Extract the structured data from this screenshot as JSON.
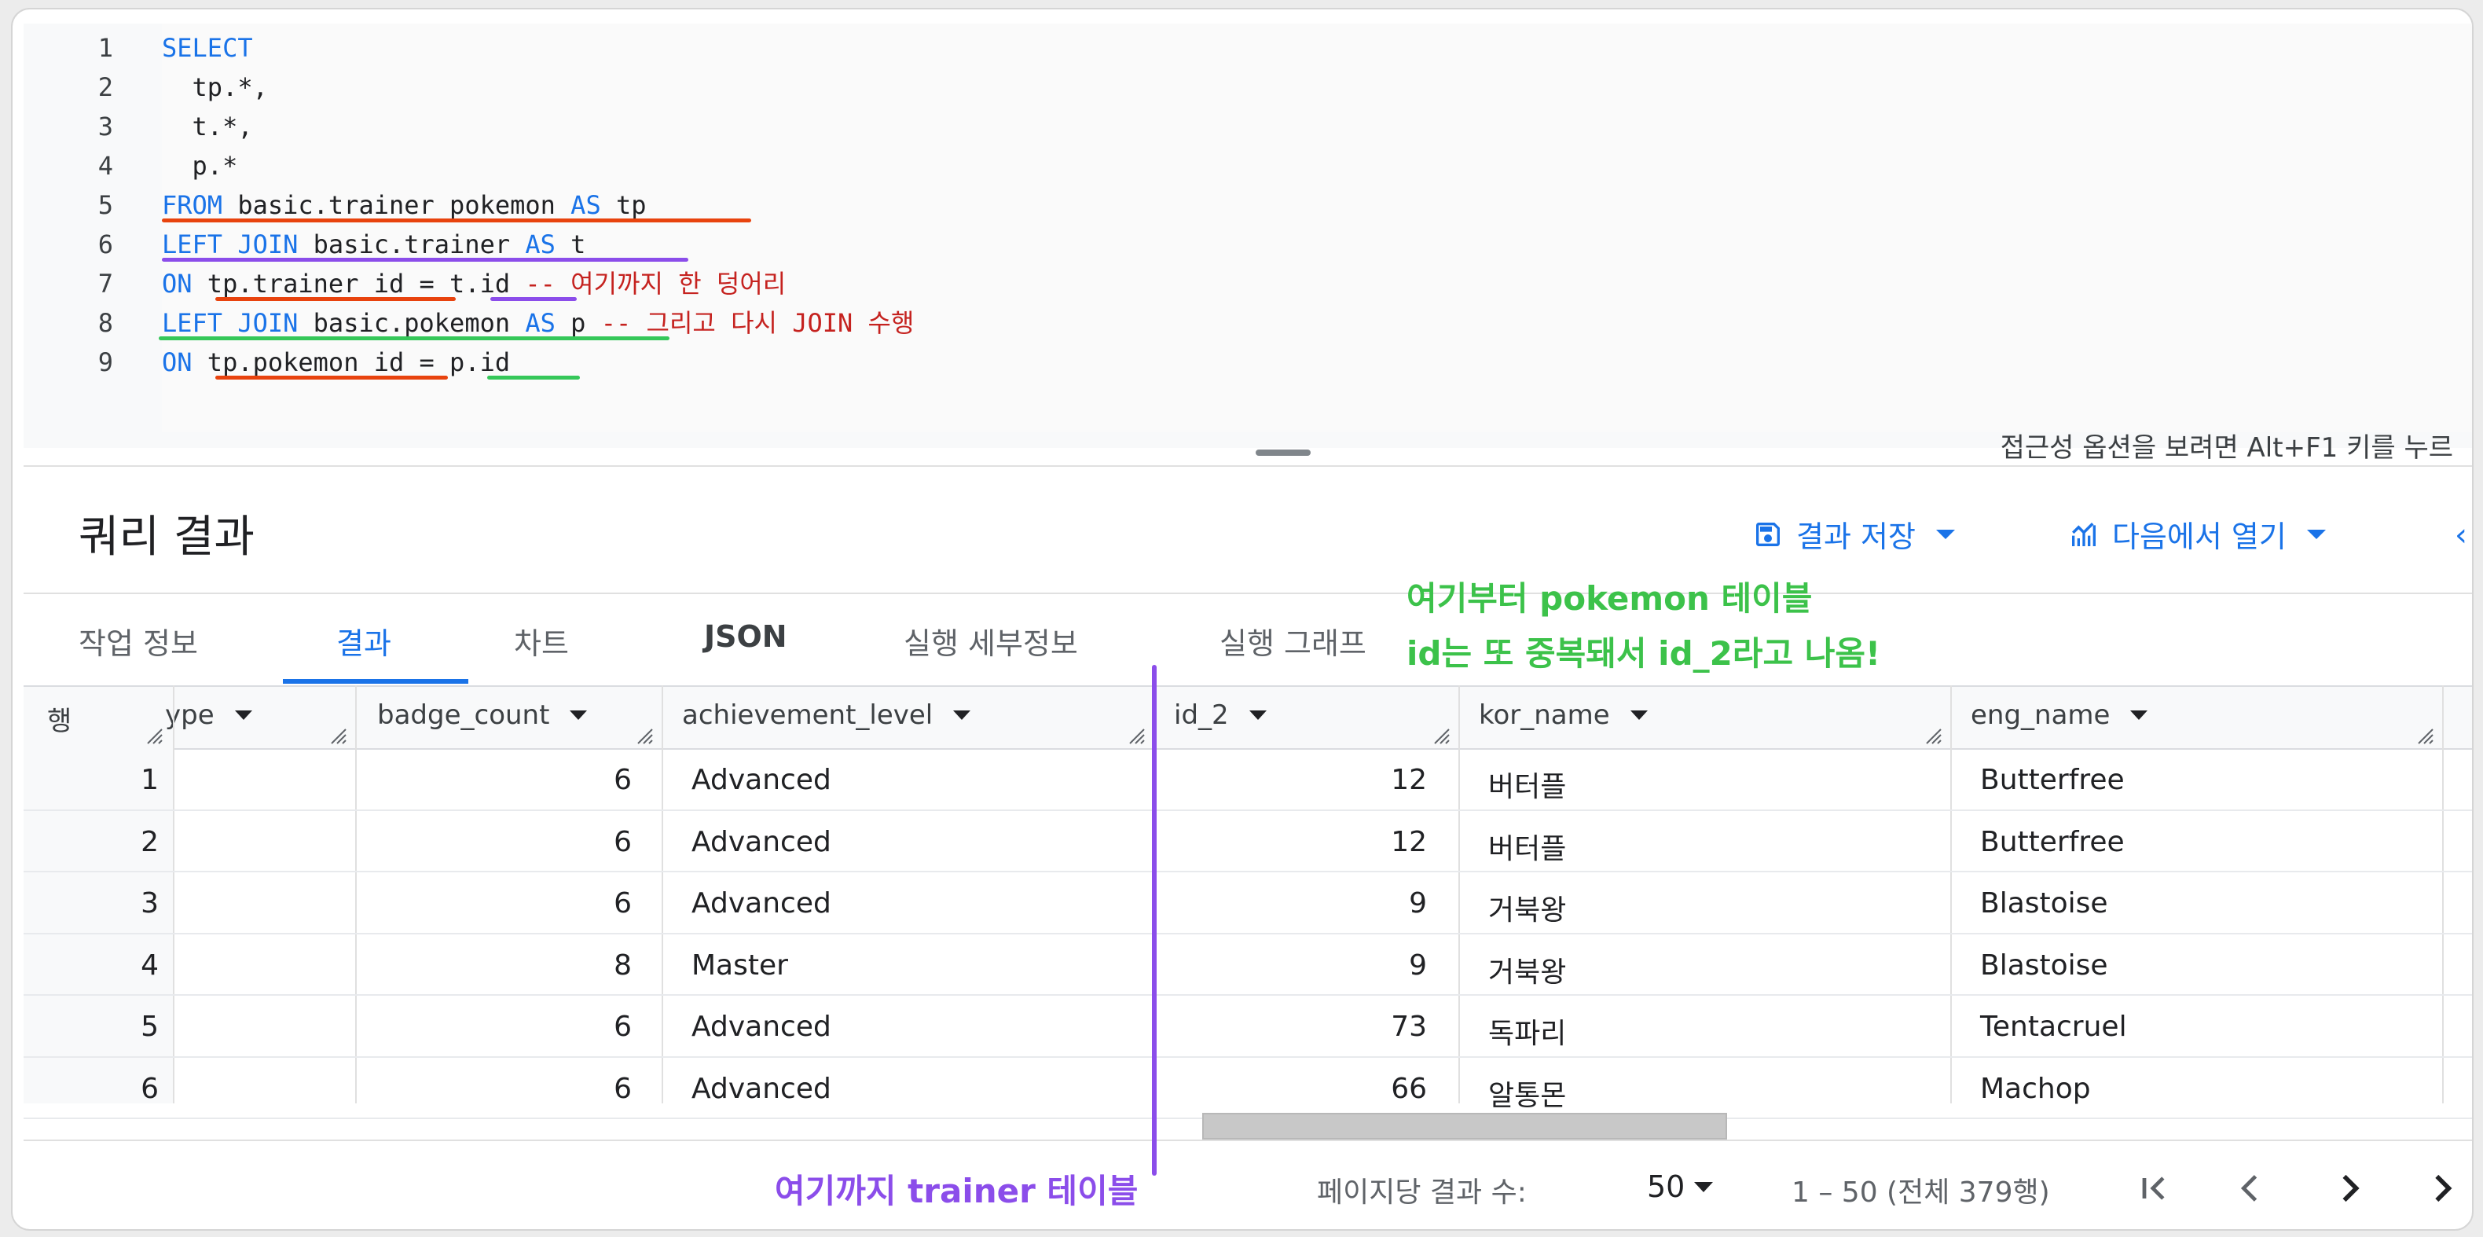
{
  "editor": {
    "line_numbers": [
      "1",
      "2",
      "3",
      "4",
      "5",
      "6",
      "7",
      "8",
      "9"
    ],
    "lines": [
      [
        {
          "t": "SELECT",
          "c": "kw"
        }
      ],
      [
        {
          "t": "  tp.*,",
          "c": ""
        }
      ],
      [
        {
          "t": "  t.*,",
          "c": ""
        }
      ],
      [
        {
          "t": "  p.*",
          "c": ""
        }
      ],
      [
        {
          "t": "FROM",
          "c": "kw"
        },
        {
          "t": " basic.trainer_pokemon ",
          "c": ""
        },
        {
          "t": "AS",
          "c": "kw"
        },
        {
          "t": " tp",
          "c": ""
        }
      ],
      [
        {
          "t": "LEFT JOIN",
          "c": "kw"
        },
        {
          "t": " basic.trainer ",
          "c": ""
        },
        {
          "t": "AS",
          "c": "kw"
        },
        {
          "t": " t",
          "c": ""
        }
      ],
      [
        {
          "t": "ON",
          "c": "kw"
        },
        {
          "t": " tp.trainer_id = t.id ",
          "c": ""
        },
        {
          "t": "-- 여기까지 한 덩어리",
          "c": "cm"
        }
      ],
      [
        {
          "t": "LEFT JOIN",
          "c": "kw"
        },
        {
          "t": " basic.pokemon ",
          "c": ""
        },
        {
          "t": "AS",
          "c": "kw"
        },
        {
          "t": " p ",
          "c": ""
        },
        {
          "t": "-- 그리고 다시 JOIN 수행",
          "c": "cm"
        }
      ],
      [
        {
          "t": "ON",
          "c": "kw"
        },
        {
          "t": " tp.pokemon_id = p.id",
          "c": ""
        }
      ]
    ],
    "accessibility_hint": "접근성 옵션을 보려면 Alt+F1 키를 누르"
  },
  "results": {
    "title": "쿼리 결과",
    "save_label": "결과 저장",
    "open_label": "다음에서 열기"
  },
  "tabs": [
    "작업 정보",
    "결과",
    "차트",
    "JSON",
    "실행 세부정보",
    "실행 그래프"
  ],
  "table": {
    "rownum_header": "행",
    "columns": [
      "ype",
      "badge_count",
      "achievement_level",
      "id_2",
      "kor_name",
      "eng_name"
    ],
    "rows": [
      {
        "n": "1",
        "badge_count": "6",
        "achievement_level": "Advanced",
        "id_2": "12",
        "kor_name": "버터플",
        "eng_name": "Butterfree"
      },
      {
        "n": "2",
        "badge_count": "6",
        "achievement_level": "Advanced",
        "id_2": "12",
        "kor_name": "버터플",
        "eng_name": "Butterfree"
      },
      {
        "n": "3",
        "badge_count": "6",
        "achievement_level": "Advanced",
        "id_2": "9",
        "kor_name": "거북왕",
        "eng_name": "Blastoise"
      },
      {
        "n": "4",
        "badge_count": "8",
        "achievement_level": "Master",
        "id_2": "9",
        "kor_name": "거북왕",
        "eng_name": "Blastoise"
      },
      {
        "n": "5",
        "badge_count": "6",
        "achievement_level": "Advanced",
        "id_2": "73",
        "kor_name": "독파리",
        "eng_name": "Tentacruel"
      },
      {
        "n": "6",
        "badge_count": "6",
        "achievement_level": "Advanced",
        "id_2": "66",
        "kor_name": "알통몬",
        "eng_name": "Machop"
      }
    ]
  },
  "annotations": {
    "green_line1": "여기부터 pokemon 테이블",
    "green_line2": "id는 또 중복돼서 id_2라고 나옴!",
    "purple": "여기까지 trainer 테이블"
  },
  "pagination": {
    "per_page_label": "페이지당 결과 수:",
    "per_page_value": "50",
    "range": "1 – 50 (전체 379행)"
  },
  "colors": {
    "accent": "#1a73e8",
    "underline_red": "#e8430e",
    "underline_purple": "#8b4dea",
    "underline_green": "#35c759"
  },
  "icons": [
    "save-icon",
    "insights-icon",
    "first-page-icon",
    "prev-page-icon",
    "next-page-icon",
    "last-page-icon"
  ]
}
